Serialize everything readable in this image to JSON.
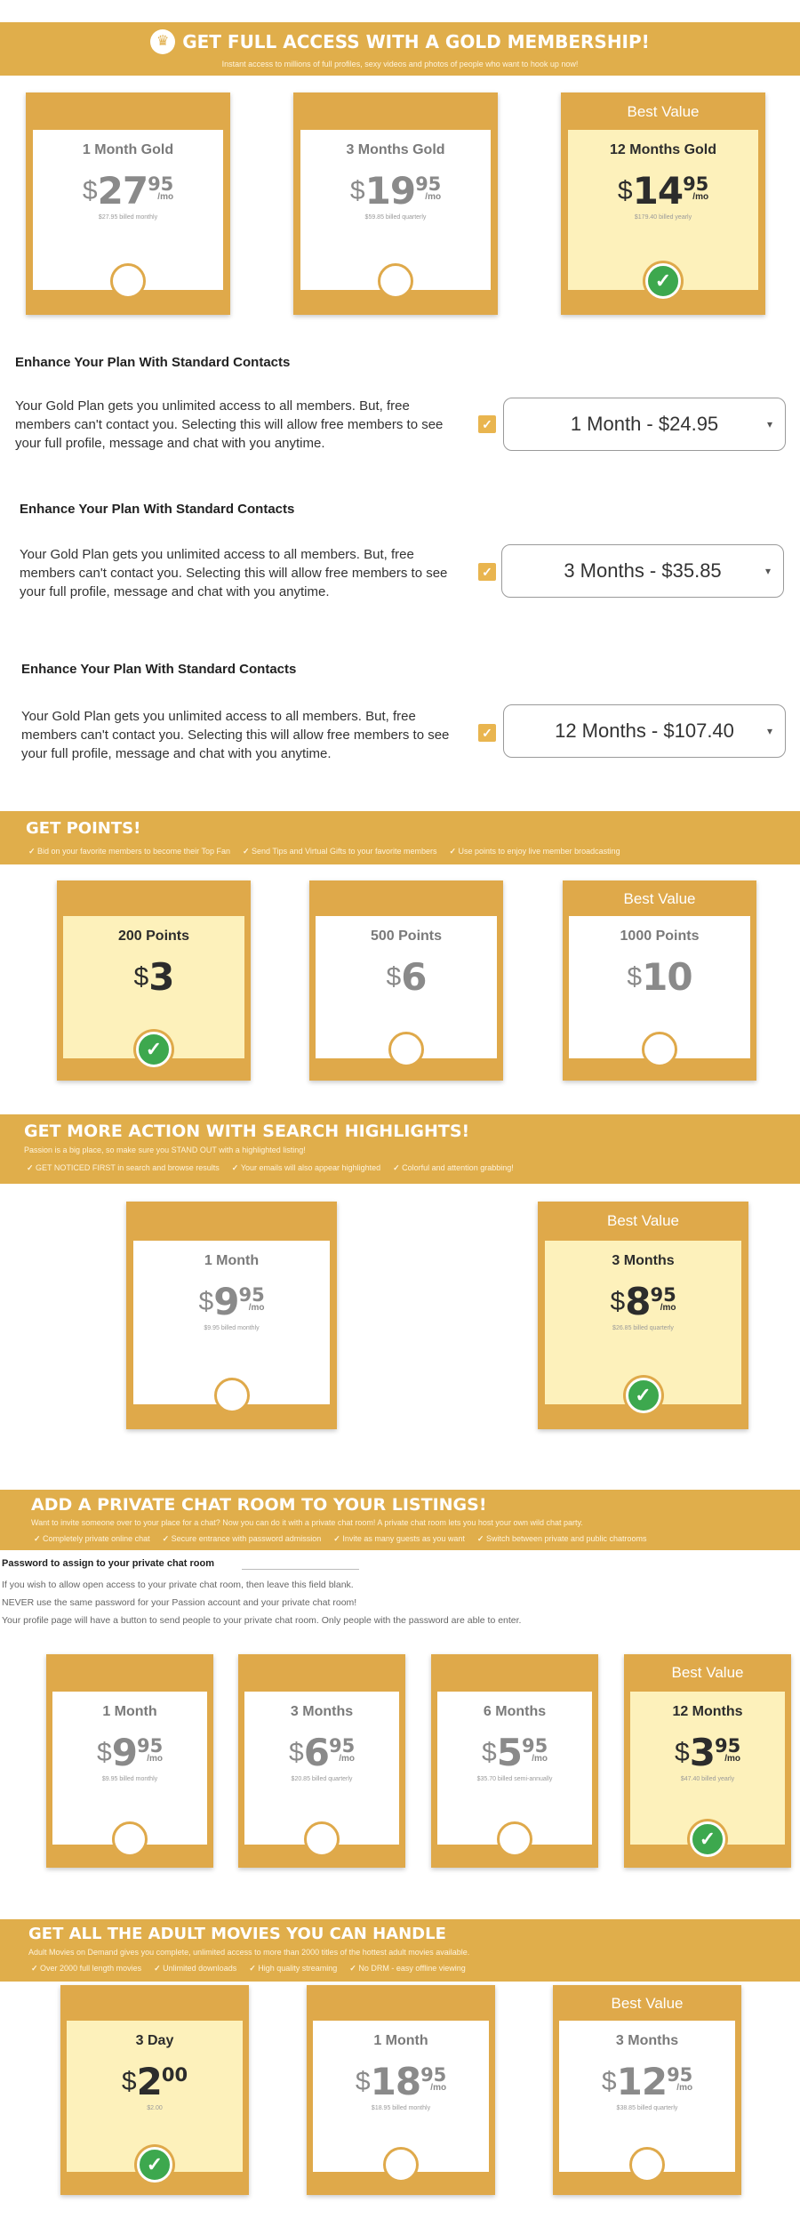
{
  "gold": {
    "title": "GET FULL ACCESS WITH A GOLD MEMBERSHIP!",
    "subtitle": "Instant access to millions of full profiles, sexy videos and photos of people who want to hook up now!",
    "crown_icon": "crown-icon",
    "plans": [
      {
        "name": "1 Month Gold",
        "dollars": "27",
        "cents": "95",
        "per": "/mo",
        "billed": "$27.95 billed monthly",
        "selected": false
      },
      {
        "name": "3 Months Gold",
        "dollars": "19",
        "cents": "95",
        "per": "/mo",
        "billed": "$59.85 billed quarterly",
        "selected": false
      },
      {
        "name": "12 Months Gold",
        "dollars": "14",
        "cents": "95",
        "per": "/mo",
        "billed": "$179.40 billed yearly",
        "selected": true,
        "badge": "Best Value"
      }
    ]
  },
  "enhance": [
    {
      "title": "Enhance Your Plan With Standard Contacts",
      "text": "Your Gold Plan gets you unlimited access to all members. But, free members can't contact you. Selecting this will allow free members to see your full profile, message and chat with you anytime.",
      "checked": true,
      "option": "1 Month - $24.95"
    },
    {
      "title": "Enhance Your Plan With Standard Contacts",
      "text": "Your Gold Plan gets you unlimited access to all members. But, free members can't contact you. Selecting this will allow free members to see your full profile, message and chat with you anytime.",
      "checked": true,
      "option": "3 Months - $35.85"
    },
    {
      "title": "Enhance Your Plan With Standard Contacts",
      "text": "Your Gold Plan gets you unlimited access to all members. But, free members can't contact you. Selecting this will allow free members to see your full profile, message and chat with you anytime.",
      "checked": true,
      "option": "12 Months - $107.40"
    }
  ],
  "points": {
    "title": "GET POINTS!",
    "features": [
      "Bid on your favorite members to become their Top Fan",
      "Send Tips and Virtual Gifts to your favorite members",
      "Use points to enjoy live member broadcasting"
    ],
    "plans": [
      {
        "name": "200 Points",
        "dollars": "3",
        "selected": true
      },
      {
        "name": "500 Points",
        "dollars": "6",
        "selected": false
      },
      {
        "name": "1000 Points",
        "dollars": "10",
        "selected": false,
        "badge": "Best Value"
      }
    ]
  },
  "highlights": {
    "title": "GET MORE ACTION WITH SEARCH HIGHLIGHTS!",
    "subtitle": "Passion is a big place, so make sure you STAND OUT with a highlighted listing!",
    "features": [
      "GET NOTICED FIRST in search and browse results",
      "Your emails will also appear highlighted",
      "Colorful and attention grabbing!"
    ],
    "plans": [
      {
        "name": "1 Month",
        "dollars": "9",
        "cents": "95",
        "per": "/mo",
        "billed": "$9.95 billed monthly",
        "selected": false
      },
      {
        "name": "3 Months",
        "dollars": "8",
        "cents": "95",
        "per": "/mo",
        "billed": "$26.85 billed quarterly",
        "selected": true,
        "badge": "Best Value"
      }
    ]
  },
  "chat": {
    "title": "ADD A PRIVATE CHAT ROOM TO YOUR LISTINGS!",
    "subtitle": "Want to invite someone over to your place for a chat? Now you can do it with a private chat room! A private chat room lets you host your own wild chat party.",
    "features": [
      "Completely private online chat",
      "Secure entrance with password admission",
      "Invite as many guests as you want",
      "Switch between private and public chatrooms"
    ],
    "password_label": "Password to assign to your private chat room",
    "info": [
      "If you wish to allow open access to your private chat room, then leave this field blank.",
      "NEVER use the same password for your Passion account and your private chat room!",
      "Your profile page will have a button to send people to your private chat room. Only people with the password are able to enter."
    ],
    "plans": [
      {
        "name": "1 Month",
        "dollars": "9",
        "cents": "95",
        "per": "/mo",
        "billed": "$9.95 billed monthly",
        "selected": false
      },
      {
        "name": "3 Months",
        "dollars": "6",
        "cents": "95",
        "per": "/mo",
        "billed": "$20.85 billed quarterly",
        "selected": false
      },
      {
        "name": "6 Months",
        "dollars": "5",
        "cents": "95",
        "per": "/mo",
        "billed": "$35.70 billed semi-annually",
        "selected": false
      },
      {
        "name": "12 Months",
        "dollars": "3",
        "cents": "95",
        "per": "/mo",
        "billed": "$47.40 billed yearly",
        "selected": true,
        "badge": "Best Value"
      }
    ]
  },
  "movies": {
    "title": "GET ALL THE ADULT MOVIES YOU CAN HANDLE",
    "subtitle": "Adult Movies on Demand gives you complete, unlimited access to more than 2000 titles of the hottest adult movies available.",
    "features": [
      "Over 2000 full length movies",
      "Unlimited downloads",
      "High quality streaming",
      "No DRM - easy offline viewing"
    ],
    "plans": [
      {
        "name": "3 Day",
        "dollars": "2",
        "cents": "00",
        "per": "",
        "billed": "$2.00",
        "selected": true
      },
      {
        "name": "1 Month",
        "dollars": "18",
        "cents": "95",
        "per": "/mo",
        "billed": "$18.95 billed monthly",
        "selected": false
      },
      {
        "name": "3 Months",
        "dollars": "12",
        "cents": "95",
        "per": "/mo",
        "billed": "$38.85 billed quarterly",
        "selected": false,
        "badge": "Best Value"
      }
    ]
  }
}
